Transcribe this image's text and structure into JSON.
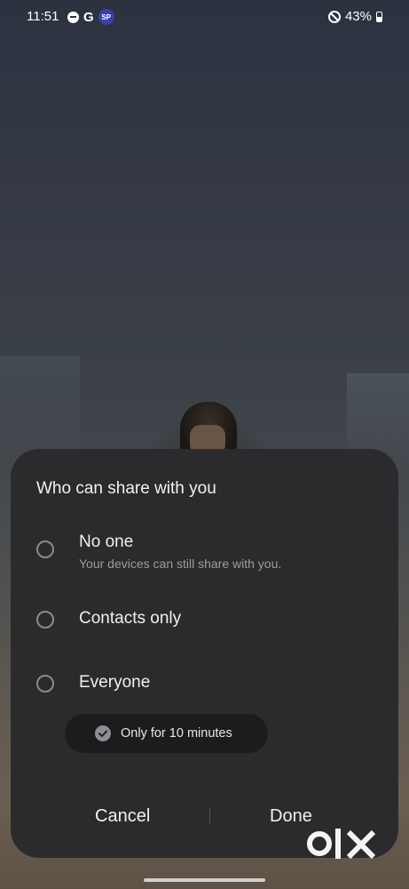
{
  "status_bar": {
    "time": "11:51",
    "google_label": "G",
    "sp_label": "SP",
    "battery": "43%"
  },
  "dialog": {
    "title": "Who can share with you",
    "options": [
      {
        "label": "No one",
        "sublabel": "Your devices can still share with you.",
        "selected": false
      },
      {
        "label": "Contacts only",
        "sublabel": "",
        "selected": false
      },
      {
        "label": "Everyone",
        "sublabel": "",
        "selected": false
      }
    ],
    "timer_option": {
      "label": "Only for 10 minutes",
      "checked": true
    },
    "buttons": {
      "cancel": "Cancel",
      "done": "Done"
    }
  },
  "watermark": {
    "text": "OLX"
  }
}
